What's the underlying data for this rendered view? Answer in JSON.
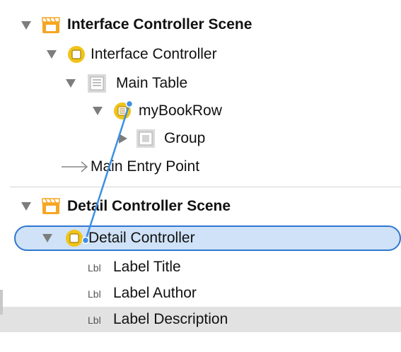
{
  "outline": {
    "scene1": {
      "label": "Interface Controller Scene"
    },
    "controller1": {
      "label": "Interface Controller"
    },
    "table": {
      "label": "Main Table"
    },
    "row": {
      "label": "myBookRow"
    },
    "group": {
      "label": "Group"
    },
    "entry": {
      "label": "Main Entry Point"
    },
    "scene2": {
      "label": "Detail Controller Scene"
    },
    "controller2": {
      "label": "Detail Controller"
    },
    "labels": [
      {
        "badge": "Lbl",
        "label": "Label Title"
      },
      {
        "badge": "Lbl",
        "label": "Label Author"
      },
      {
        "badge": "Lbl",
        "label": "Label Description"
      }
    ]
  },
  "colors": {
    "selection": "#cfe2f7",
    "accent": "#2e77d0",
    "scene_icon": "#f5a623",
    "controller_icon": "#f0c419",
    "highlight_row": "#e2e2e2"
  }
}
